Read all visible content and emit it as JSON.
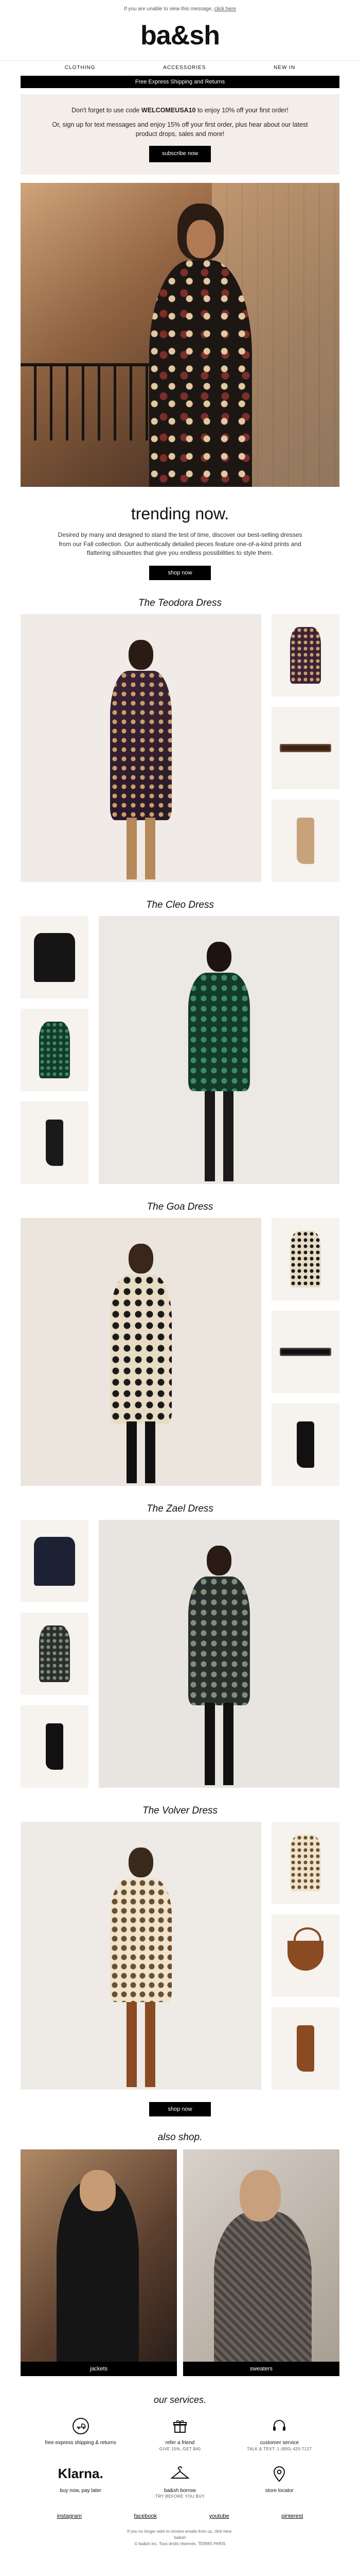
{
  "preheader": {
    "text": "If you are unable to view this message,",
    "link": "click here"
  },
  "brand": {
    "logo": "ba&sh"
  },
  "nav": {
    "items": [
      "CLOTHING",
      "ACCESSORIES",
      "NEW IN"
    ]
  },
  "banner": {
    "text": "Free Express Shipping and Returns"
  },
  "promo": {
    "line1_pre": "Don't forget to use code ",
    "code": "WELCOMEUSA10",
    "line1_post": " to enjoy 10% off your first order!",
    "line2": "Or, sign up for text messages and enjoy 15% off your first order, plus hear about our latest product drops, sales and more!",
    "button": "subscribe now"
  },
  "trending": {
    "title": "trending now.",
    "text": "Desired by many and designed to stand the test of time, discover our best-selling dresses from our Fall collection. Our authentically detailed pieces feature one-of-a-kind prints and flattering silhouettes that give you endless possibilities to style them.",
    "button": "shop now"
  },
  "products": [
    {
      "title": "The Teodora Dress"
    },
    {
      "title": "The Cleo Dress"
    },
    {
      "title": "The Goa Dress"
    },
    {
      "title": "The Zael Dress"
    },
    {
      "title": "The Volver Dress"
    }
  ],
  "shop_now_bottom": "shop now",
  "also_shop": {
    "title": "also shop.",
    "items": [
      {
        "label": "jackets"
      },
      {
        "label": "sweaters"
      }
    ]
  },
  "services": {
    "title": "our services.",
    "items": [
      {
        "label": "free express shipping & returns",
        "sub": "",
        "icon": "truck-icon"
      },
      {
        "label": "refer a friend",
        "sub": "GIVE 15%, GET $40",
        "icon": "gift-icon"
      },
      {
        "label": "customer service",
        "sub": "TALK & TEXT: 1 (800) 420-7127",
        "icon": "headset-icon"
      },
      {
        "label": "buy now, pay later",
        "sub": "",
        "icon": "klarna-logo",
        "logo_text": "Klarna."
      },
      {
        "label": "ba&sh borrow",
        "sub": "TRY BEFORE YOU BUY",
        "icon": "hanger-icon"
      },
      {
        "label": "store locator",
        "sub": "",
        "icon": "pin-icon"
      }
    ]
  },
  "social": {
    "items": [
      "instagram",
      "facebook",
      "youtube",
      "pinterest"
    ]
  },
  "footer": {
    "line1": "If you no longer wish to receive emails from us, click here.",
    "line2": "ba&sh",
    "line3": "© ba&sh inc. Tous droits réservés. TERMS PARIS"
  },
  "colors": {
    "accent": "#000000",
    "promo_bg": "#f4eeea"
  }
}
